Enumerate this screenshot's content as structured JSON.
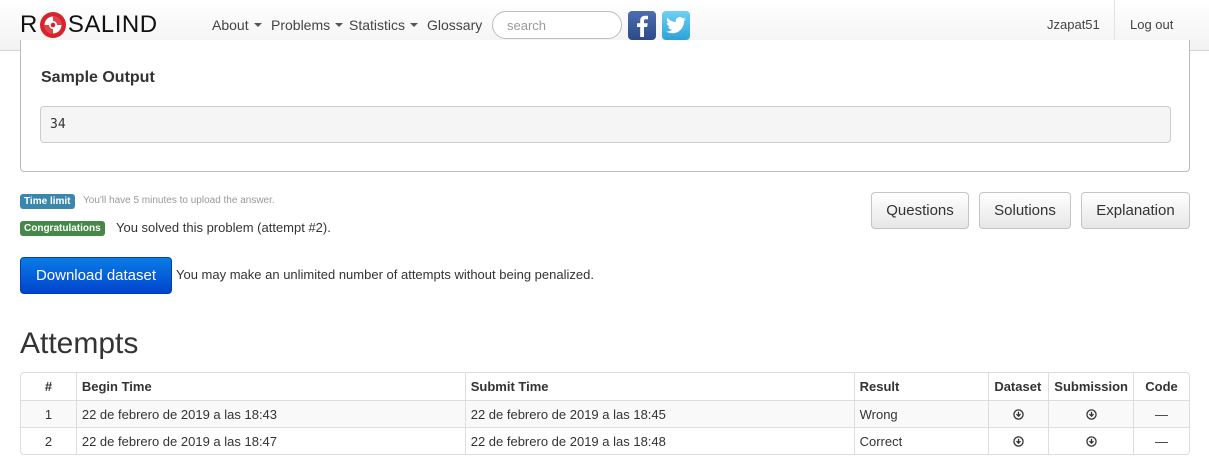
{
  "navbar": {
    "brand_left": "R",
    "brand_right": "SALIND",
    "menu": [
      {
        "label": "About",
        "dropdown": true
      },
      {
        "label": "Problems",
        "dropdown": true
      },
      {
        "label": "Statistics",
        "dropdown": true
      },
      {
        "label": "Glossary",
        "dropdown": false
      }
    ],
    "search_placeholder": "search",
    "social": [
      "facebook-icon",
      "twitter-icon"
    ],
    "username": "Jzapat51",
    "logout": "Log out"
  },
  "sample": {
    "title": "Sample Output",
    "value": "34"
  },
  "status": {
    "time_label": "Time limit",
    "time_text": "You'll have 5 minutes to upload the answer.",
    "congrats_label": "Congratulations",
    "congrats_text": "You solved this problem (attempt #2)."
  },
  "buttons": {
    "questions": "Questions",
    "solutions": "Solutions",
    "explanation": "Explanation",
    "download": "Download dataset"
  },
  "download_text": "You may make an unlimited number of attempts without being penalized.",
  "attempts": {
    "title": "Attempts",
    "columns": [
      "#",
      "Begin Time",
      "Submit Time",
      "Result",
      "Dataset",
      "Submission",
      "Code"
    ],
    "rows": [
      {
        "num": "1",
        "begin": "22 de febrero de 2019 a las 18:43",
        "submit": "22 de febrero de 2019 a las 18:45",
        "result": "Wrong",
        "code": "—"
      },
      {
        "num": "2",
        "begin": "22 de febrero de 2019 a las 18:47",
        "submit": "22 de febrero de 2019 a las 18:48",
        "result": "Correct",
        "code": "—"
      }
    ]
  },
  "colors": {
    "primary": "#0055d4",
    "label_info": "#3a87ad",
    "label_success": "#468847",
    "logo_red": "#d9232a"
  }
}
